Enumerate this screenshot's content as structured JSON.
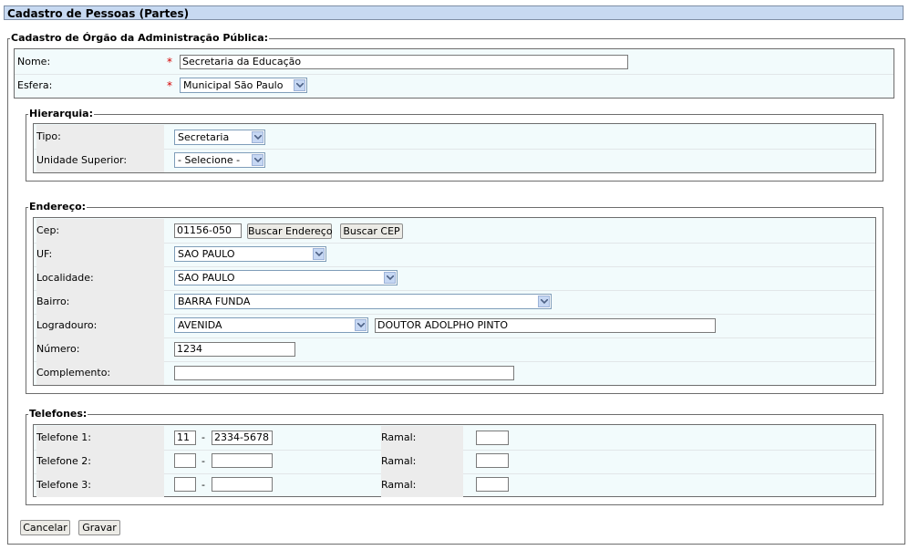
{
  "page": {
    "title": "Cadastro de Pessoas (Partes)"
  },
  "orgao": {
    "legend": "Cadastro de Órgão da Administração Pública:",
    "nome": {
      "label": "Nome:",
      "value": "Secretaria da Educação",
      "required": "*"
    },
    "esfera": {
      "label": "Esfera:",
      "value": "Municipal São Paulo",
      "required": "*"
    }
  },
  "hierarquia": {
    "legend": "Hierarquia:",
    "tipo": {
      "label": "Tipo:",
      "value": "Secretaria"
    },
    "unidade_superior": {
      "label": "Unidade Superior:",
      "value": "- Selecione -"
    }
  },
  "endereco": {
    "legend": "Endereço:",
    "cep": {
      "label": "Cep:",
      "value": "01156-050"
    },
    "buscar_endereco": "Buscar Endereço",
    "buscar_cep": "Buscar CEP",
    "uf": {
      "label": "UF:",
      "value": "SAO PAULO"
    },
    "localidade": {
      "label": "Localidade:",
      "value": "SAO PAULO"
    },
    "bairro": {
      "label": "Bairro:",
      "value": "BARRA FUNDA"
    },
    "logradouro": {
      "label": "Logradouro:",
      "tipo": "AVENIDA",
      "nome": "DOUTOR ADOLPHO PINTO"
    },
    "numero": {
      "label": "Número:",
      "value": "1234"
    },
    "complemento": {
      "label": "Complemento:",
      "value": ""
    }
  },
  "telefones": {
    "legend": "Telefones:",
    "separator": "-",
    "ramal_label": "Ramal:",
    "items": [
      {
        "label": "Telefone 1:",
        "ddd": "11",
        "numero": "2334-5678",
        "ramal": ""
      },
      {
        "label": "Telefone 2:",
        "ddd": "",
        "numero": "",
        "ramal": ""
      },
      {
        "label": "Telefone 3:",
        "ddd": "",
        "numero": "",
        "ramal": ""
      }
    ]
  },
  "actions": {
    "cancelar": "Cancelar",
    "gravar": "Gravar"
  }
}
